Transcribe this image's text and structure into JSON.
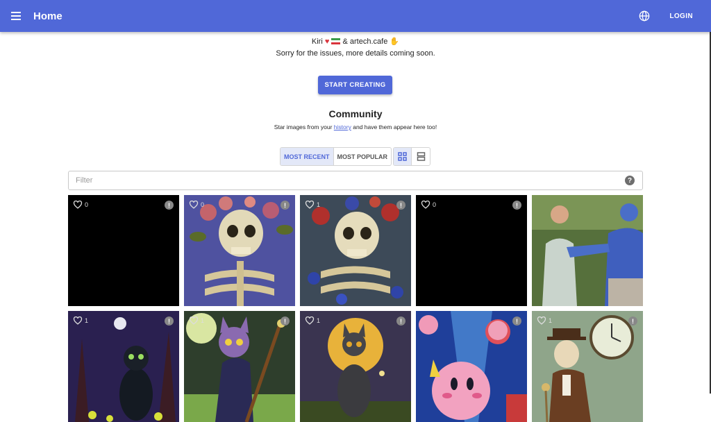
{
  "header": {
    "title": "Home",
    "login_label": "LOGIN"
  },
  "notice": {
    "line1_name": "Kiri",
    "line1_suffix": "& artech.cafe",
    "line2": "Sorry for the issues, more details coming soon."
  },
  "start_button": {
    "label": "START CREATING"
  },
  "community": {
    "title": "Community",
    "subtitle_before": "Star images from your",
    "subtitle_link": "history",
    "subtitle_after": "and have them appear here too!"
  },
  "sort_tabs": [
    {
      "label": "MOST RECENT",
      "active": true
    },
    {
      "label": "MOST POPULAR",
      "active": false
    }
  ],
  "view_modes": [
    "grid-view-icon",
    "list-view-icon"
  ],
  "filter": {
    "placeholder": "Filter",
    "value": ""
  },
  "tiles": [
    {
      "likes": "0",
      "subject": "black image"
    },
    {
      "likes": "0",
      "subject": "skeleton with flowers"
    },
    {
      "likes": "1",
      "subject": "skeleton with roses"
    },
    {
      "likes": "0",
      "subject": "black image"
    },
    {
      "likes": "",
      "subject": "man and blue figure"
    },
    {
      "likes": "1",
      "subject": "cat in dark forest"
    },
    {
      "likes": "1",
      "subject": "cat wizard"
    },
    {
      "likes": "1",
      "subject": "cat and full moon"
    },
    {
      "likes": "",
      "subject": "kirby"
    },
    {
      "likes": "1",
      "subject": "dog with clock"
    }
  ],
  "colors": {
    "primary": "#5068d8",
    "heart": "#d9343c"
  }
}
